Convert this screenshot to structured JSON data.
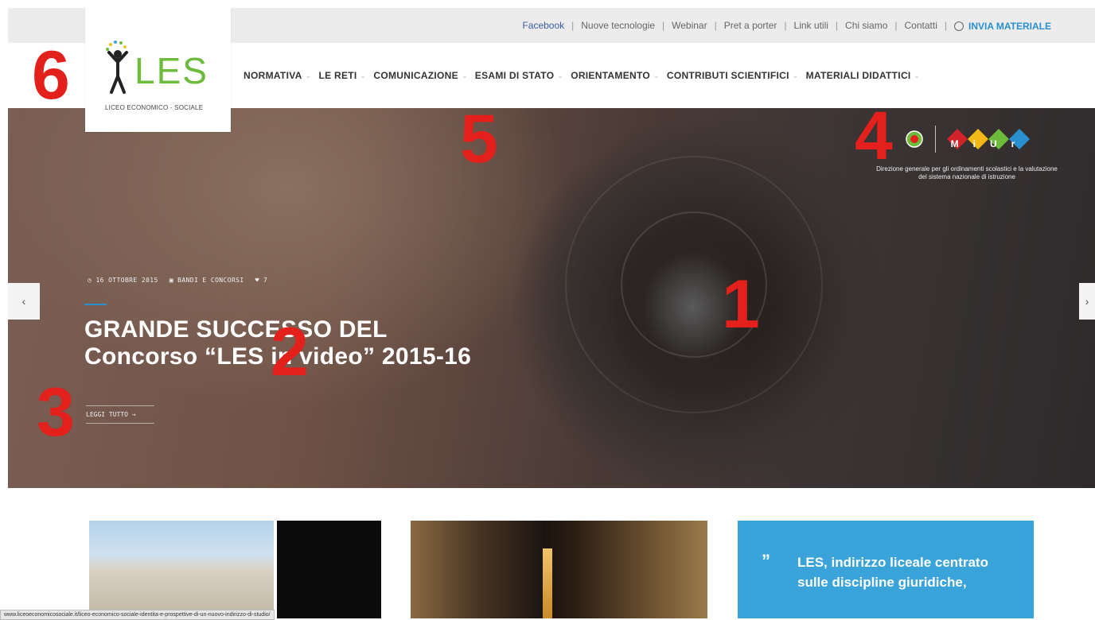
{
  "topbar": {
    "links": [
      "Facebook",
      "Nuove tecnologie",
      "Webinar",
      "Pret a porter",
      "Link utili",
      "Chi siamo",
      "Contatti"
    ],
    "send_label": "INVIA MATERIALE"
  },
  "logo": {
    "text": "LES",
    "subtitle": "LICEO ECONOMICO - SOCIALE"
  },
  "nav": {
    "items": [
      "NORMATIVA",
      "LE RETI",
      "COMUNICAZIONE",
      "ESAMI DI STATO",
      "ORIENTAMENTO",
      "CONTRIBUTI SCIENTIFICI",
      "MATERIALI DIDATTICI"
    ]
  },
  "hero": {
    "date": "16 OTTOBRE 2015",
    "category": "BANDI E CONCORSI",
    "likes": "7",
    "title_line1": "GRANDE SUCCESSO DEL",
    "title_line2": "Concorso “LES in video” 2015-16",
    "read_more": "LEGGI TUTTO →",
    "miur_letters": [
      "M",
      "i",
      "U",
      "r"
    ],
    "miur_caption": "Direzione generale per gli ordinamenti scolastici e la valutazione del sistema nazionale di istruzione"
  },
  "annotations": [
    "1",
    "2",
    "3",
    "4",
    "5",
    "6"
  ],
  "quote": {
    "text": "LES, indirizzo liceale centrato sulle discipline giuridiche,"
  },
  "statusbar": {
    "url": "www.liceoeconomicosociale.it/liceo-economico-sociale-identita-e-prospettive-di-un-nuovo-indirizzo-di-studio/"
  },
  "colors": {
    "accent_blue": "#2a8fcf",
    "logo_green": "#6dbb3b",
    "annotation_red": "#e3201b",
    "quote_bg": "#3aa3d9"
  }
}
